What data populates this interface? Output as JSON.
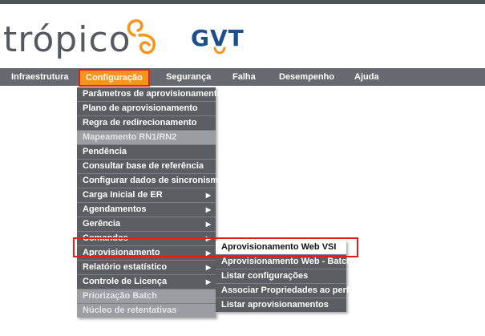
{
  "brand": {
    "tropico": "trópico",
    "gvt": "GVT"
  },
  "colors": {
    "menubar": "#666a70",
    "active_menu": "#f7941d",
    "highlight_border": "#e02020",
    "dropdown_bg": "#5a5e63",
    "logo_accent": "#f7941d",
    "gvt_blue": "#1c4f8c"
  },
  "menu": {
    "items": [
      "Infraestrutura",
      "Configuração",
      "Segurança",
      "Falha",
      "Desempenho",
      "Ajuda"
    ]
  },
  "dropdown": {
    "items": [
      {
        "label": "Parâmetros de aprovisionamento"
      },
      {
        "label": "Plano de aprovisionamento"
      },
      {
        "label": "Regra de redirecionamento"
      },
      {
        "label": "Mapeamento RN1/RN2",
        "disabled": true
      },
      {
        "label": "Pendência"
      },
      {
        "label": "Consultar base de referência"
      },
      {
        "label": "Configurar dados de sincronismo"
      },
      {
        "label": "Carga Inicial de ER",
        "submenu": true
      },
      {
        "label": "Agendamentos",
        "submenu": true
      },
      {
        "label": "Gerência",
        "submenu": true
      },
      {
        "label": "Comandos",
        "submenu": true
      },
      {
        "label": "Aprovisionamento",
        "submenu": true
      },
      {
        "label": "Relatório estatístico",
        "submenu": true
      },
      {
        "label": "Controle de Licença",
        "submenu": true
      },
      {
        "label": "Priorização Batch",
        "disabled": true
      },
      {
        "label": "Núcleo de retentativas",
        "disabled": true
      }
    ],
    "arrow": "▶"
  },
  "submenu": {
    "items": [
      "Aprovisionamento Web VSI",
      "Aprovisionamento Web - Batch",
      "Listar configurações",
      "Associar Propriedades ao perfil",
      "Listar aprovisionamentos"
    ]
  }
}
